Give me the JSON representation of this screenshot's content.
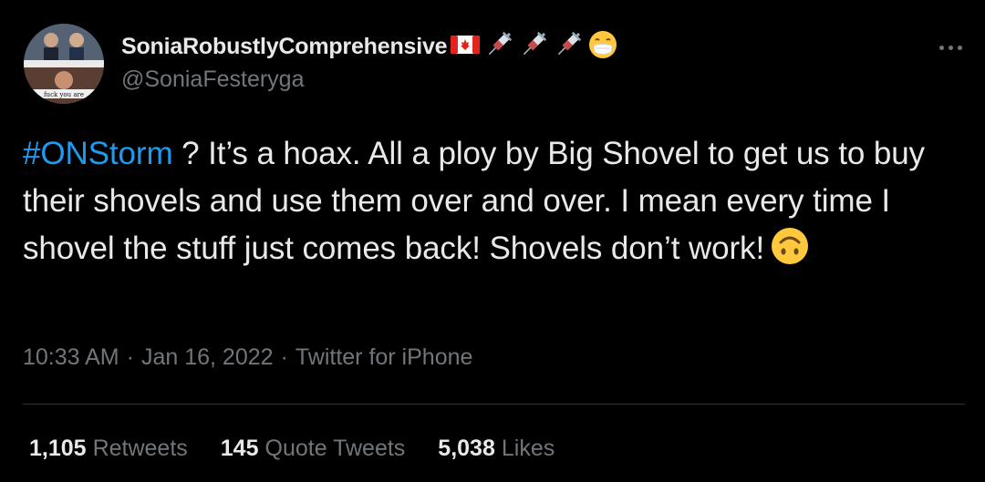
{
  "user": {
    "display_name": "SoniaRobustlyComprehensive",
    "handle": "@SoniaFesteryga",
    "name_emojis": [
      "canada-flag-icon",
      "syringe-icon",
      "syringe-icon",
      "syringe-icon",
      "face-with-mask-icon"
    ],
    "avatar_caption": "fuck you are"
  },
  "tweet": {
    "hashtag": "#ONStorm",
    "text_after_hashtag": " ? It’s a hoax. All a ploy by Big Shovel to get us to buy their shovels and use them over and over. I mean every time I shovel the stuff just comes back! Shovels don’t work!",
    "trailing_emoji": "upside-down-face-icon"
  },
  "meta": {
    "time": "10:33 AM",
    "separator": "·",
    "date": "Jan 16, 2022",
    "source": "Twitter for iPhone"
  },
  "stats": {
    "retweets_count": "1,105",
    "retweets_label": "Retweets",
    "quotes_count": "145",
    "quotes_label": "Quote Tweets",
    "likes_count": "5,038",
    "likes_label": "Likes"
  },
  "colors": {
    "background": "#000000",
    "text": "#e7e9ea",
    "secondary": "#71767b",
    "link": "#1d9bf0",
    "divider": "#2f3336"
  }
}
